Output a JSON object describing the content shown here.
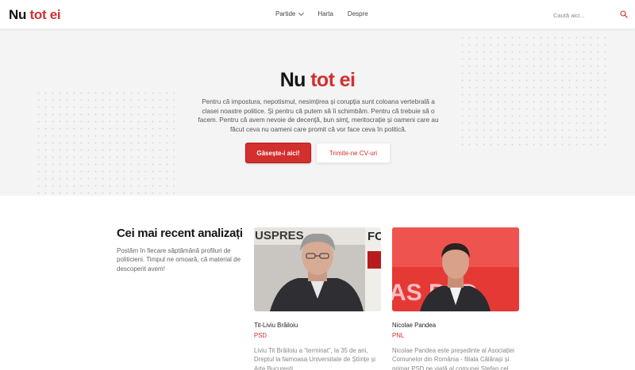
{
  "header": {
    "logo_part1": "Nu",
    "logo_part2": "tot ei",
    "nav": [
      {
        "label": "Partide"
      },
      {
        "label": "Harta"
      },
      {
        "label": "Despre"
      }
    ],
    "search_placeholder": "Caută aici..."
  },
  "hero": {
    "title_part1": "Nu",
    "title_part2": "tot ei",
    "text": "Pentru că impostura, nepotismul, nesimțirea și corupția sunt coloana vertebrală a clasei noastre politice. Și pentru că putem să îi schimbăm. Pentru că trebuie să o facem. Pentru că avem nevoie de decență, bun simț, meritocrație și oameni care au făcut ceva nu oameni care promit că vor face ceva în politică.",
    "primary_button": "Găsește-i aici!",
    "secondary_button": "Trimite-ne CV-uri"
  },
  "section": {
    "title": "Cei mai recent analizați",
    "text": "Postăm în fiecare săptămână profiluri de politicieni. Timpul ne omoară, că material de descoperit avem!"
  },
  "cards": [
    {
      "name": "Tit-Liviu Brăiloiu",
      "party": "PSD",
      "description": "Liviu Tit Brăiloiu a “terminat”, la 35 de ani, Dreptul la faimoasa Universitate de Științe și Arte București. ...",
      "photo_text_top": "USPRES",
      "photo_text_right": "FC"
    },
    {
      "name": "Nicolae Pandea",
      "party": "PNL",
      "description": "Nicolae Pandea este președinte al Asociației Comunelor din România - filiala Călărași și primar PSD pe viață al comunei Ștefan cel Mare.",
      "photo_text": "AS PSD"
    }
  ],
  "colors": {
    "brand_red": "#d32f2f",
    "hero_bg": "#f4f4f4"
  }
}
